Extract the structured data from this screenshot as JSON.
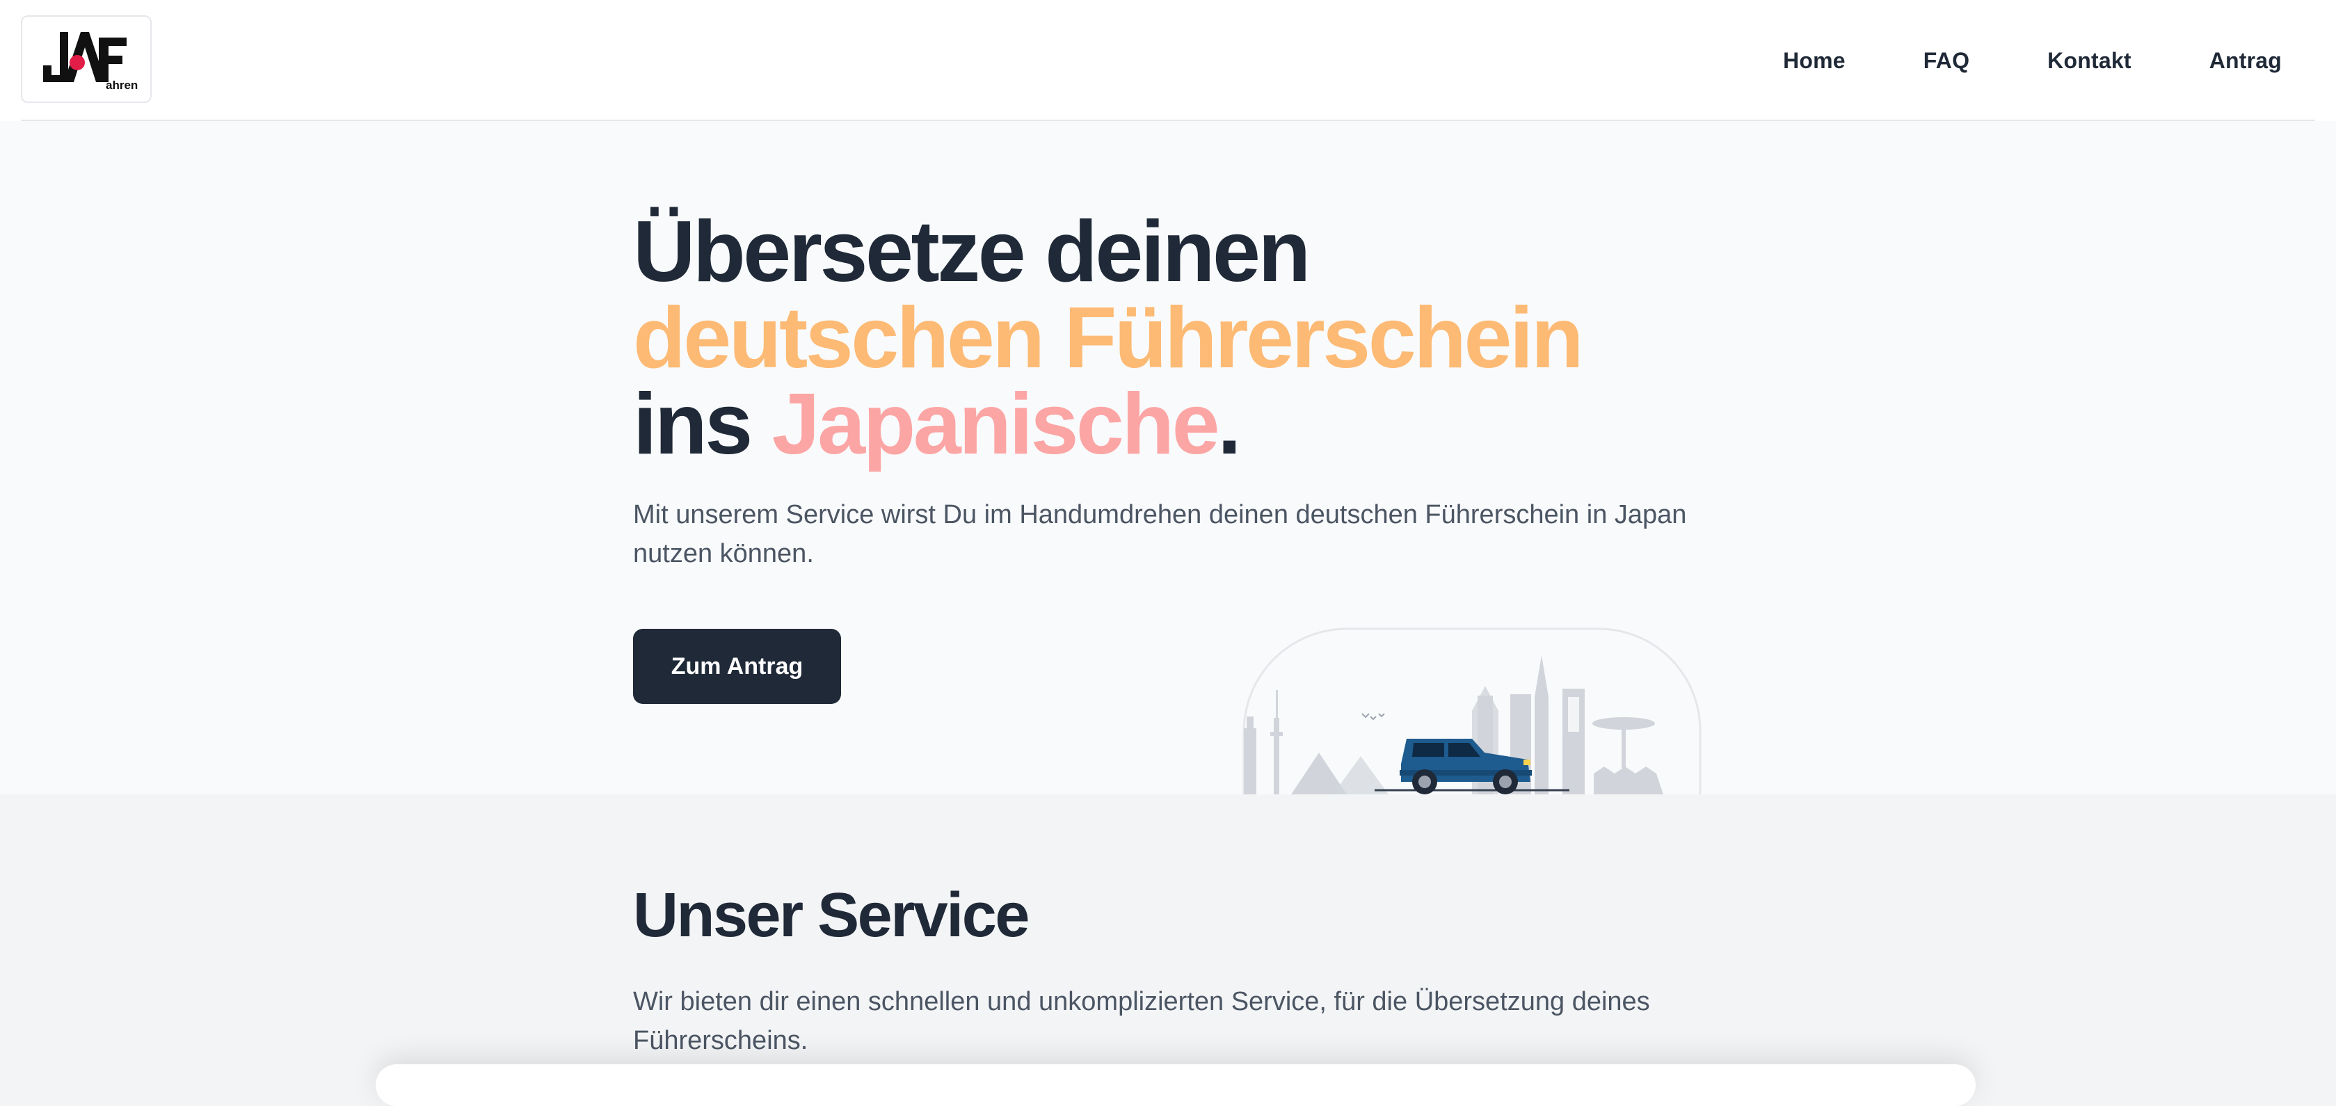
{
  "logo": {
    "letters_left": "JA",
    "letter_right": "F",
    "suffix": "ahren"
  },
  "nav": {
    "items": [
      {
        "label": "Home"
      },
      {
        "label": "FAQ"
      },
      {
        "label": "Kontakt"
      },
      {
        "label": "Antrag"
      }
    ]
  },
  "hero": {
    "title_line1": "Übersetze deinen",
    "title_line2": "deutschen Führerschein",
    "title_line3_a": "ins ",
    "title_line3_b": "Japanische",
    "title_line3_c": ".",
    "description": "Mit unserem Service wirst Du im Handumdrehen deinen deutschen Führerschein in Japan nutzen können.",
    "cta_label": "Zum Antrag"
  },
  "service": {
    "title": "Unser Service",
    "description": "Wir bieten dir einen schnellen und unkomplizierten Service, für die Übersetzung deines Führerscheins."
  },
  "colors": {
    "dark": "#1f2937",
    "orange_accent": "#fdba74",
    "pink_accent": "#fca5a5",
    "hero_bg": "#f9fafb",
    "page_bg": "#f3f4f6",
    "car_blue": "#1e5b8f",
    "logo_red": "#e11d48"
  },
  "icons": {
    "illustration": "car-city-skyline-illustration"
  }
}
